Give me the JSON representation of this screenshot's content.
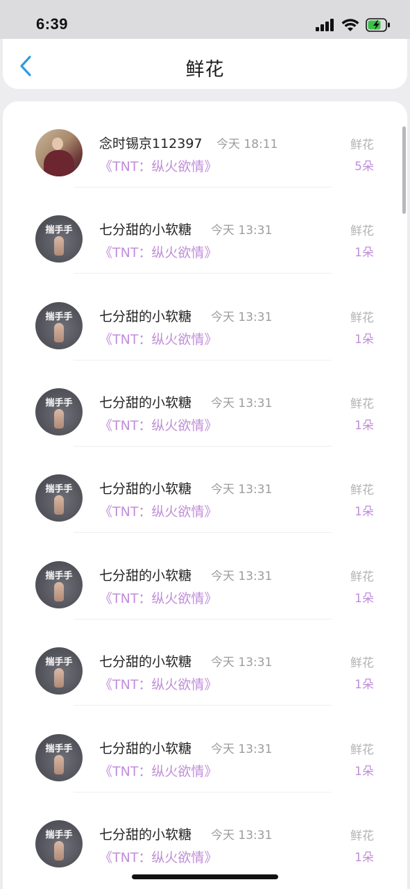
{
  "status_bar": {
    "time": "6:39"
  },
  "header": {
    "title": "鲜花"
  },
  "items": [
    {
      "name": "念时锡京112397",
      "time": "今天 18:11",
      "work": "《TNT：纵火欲情》",
      "gift_label": "鲜花",
      "gift_count": "5朵",
      "avatar_text": ""
    },
    {
      "name": "七分甜的小软糖",
      "time": "今天 13:31",
      "work": "《TNT：纵火欲情》",
      "gift_label": "鲜花",
      "gift_count": "1朵",
      "avatar_text": "揣手手"
    },
    {
      "name": "七分甜的小软糖",
      "time": "今天 13:31",
      "work": "《TNT：纵火欲情》",
      "gift_label": "鲜花",
      "gift_count": "1朵",
      "avatar_text": "揣手手"
    },
    {
      "name": "七分甜的小软糖",
      "time": "今天 13:31",
      "work": "《TNT：纵火欲情》",
      "gift_label": "鲜花",
      "gift_count": "1朵",
      "avatar_text": "揣手手"
    },
    {
      "name": "七分甜的小软糖",
      "time": "今天 13:31",
      "work": "《TNT：纵火欲情》",
      "gift_label": "鲜花",
      "gift_count": "1朵",
      "avatar_text": "揣手手"
    },
    {
      "name": "七分甜的小软糖",
      "time": "今天 13:31",
      "work": "《TNT：纵火欲情》",
      "gift_label": "鲜花",
      "gift_count": "1朵",
      "avatar_text": "揣手手"
    },
    {
      "name": "七分甜的小软糖",
      "time": "今天 13:31",
      "work": "《TNT：纵火欲情》",
      "gift_label": "鲜花",
      "gift_count": "1朵",
      "avatar_text": "揣手手"
    },
    {
      "name": "七分甜的小软糖",
      "time": "今天 13:31",
      "work": "《TNT：纵火欲情》",
      "gift_label": "鲜花",
      "gift_count": "1朵",
      "avatar_text": "揣手手"
    },
    {
      "name": "七分甜的小软糖",
      "time": "今天 13:31",
      "work": "《TNT：纵火欲情》",
      "gift_label": "鲜花",
      "gift_count": "1朵",
      "avatar_text": "揣手手"
    }
  ],
  "colors": {
    "accent_purple": "#c08ed9",
    "back_arrow_blue": "#2f9be0",
    "battery_green": "#3cc04a"
  },
  "icons": {
    "back": "chevron-left-icon",
    "signal": "signal-icon",
    "wifi": "wifi-icon",
    "battery": "battery-charging-icon"
  }
}
